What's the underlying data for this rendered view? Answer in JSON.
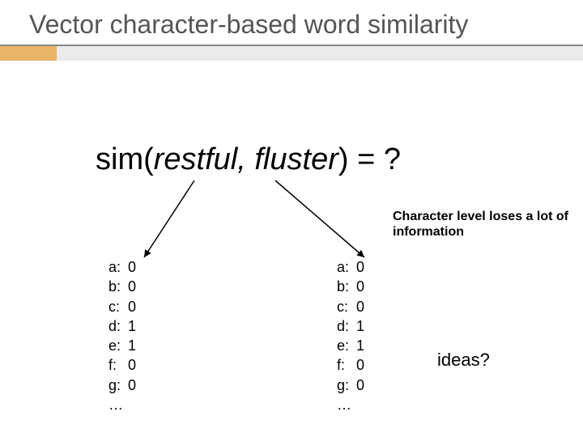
{
  "title": "Vector character-based word similarity",
  "formula": {
    "fn": "sim",
    "open": "(",
    "w1": "restful,",
    "sep": " ",
    "w2": "fluster",
    "close": ")",
    "eq": " = ?"
  },
  "note": "Character level loses a lot of information",
  "vectors": {
    "left": {
      "rows": [
        {
          "k": "a:",
          "v": "0"
        },
        {
          "k": "b:",
          "v": "0"
        },
        {
          "k": "c:",
          "v": "0"
        },
        {
          "k": "d:",
          "v": "1"
        },
        {
          "k": "e:",
          "v": "1"
        },
        {
          "k": "f:",
          "v": "0"
        },
        {
          "k": "g:",
          "v": "0"
        },
        {
          "k": "…",
          "v": ""
        }
      ]
    },
    "right": {
      "rows": [
        {
          "k": "a:",
          "v": "0"
        },
        {
          "k": "b:",
          "v": "0"
        },
        {
          "k": "c:",
          "v": "0"
        },
        {
          "k": "d:",
          "v": "1"
        },
        {
          "k": "e:",
          "v": "1"
        },
        {
          "k": "f:",
          "v": "0"
        },
        {
          "k": "g:",
          "v": "0"
        },
        {
          "k": "…",
          "v": ""
        }
      ]
    }
  },
  "ideas": "ideas?"
}
